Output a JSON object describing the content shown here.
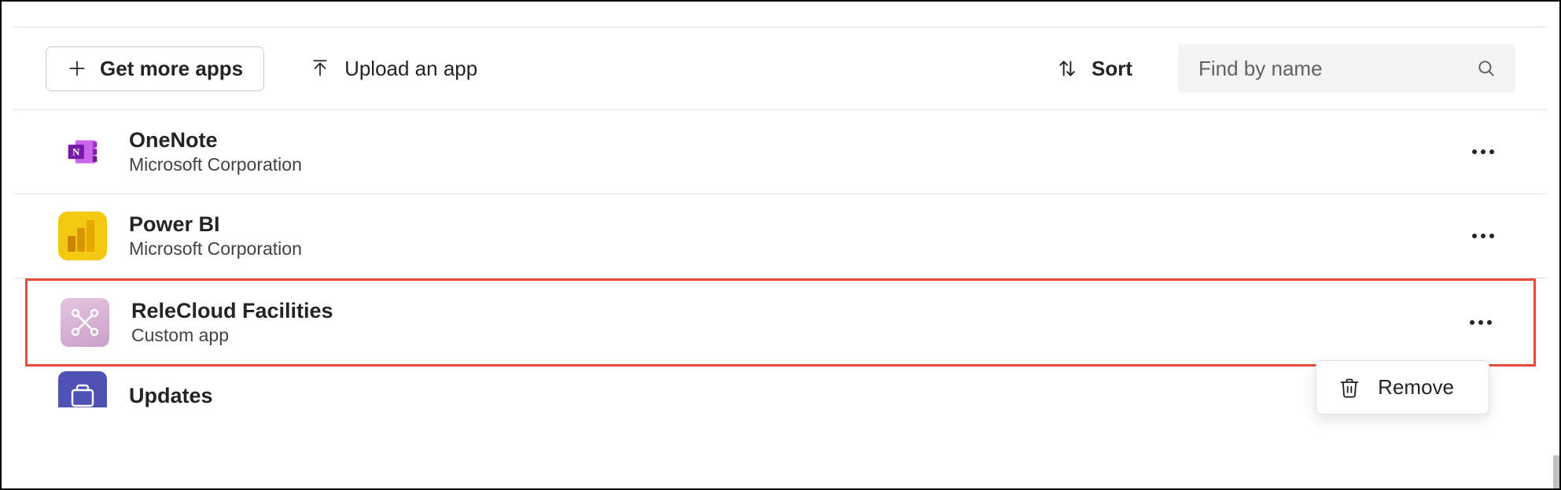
{
  "toolbar": {
    "get_more_apps": "Get more apps",
    "upload_app": "Upload an app",
    "sort": "Sort",
    "search_placeholder": "Find by name"
  },
  "apps": [
    {
      "name": "OneNote",
      "publisher": "Microsoft Corporation",
      "icon": "onenote"
    },
    {
      "name": "Power BI",
      "publisher": "Microsoft Corporation",
      "icon": "powerbi"
    },
    {
      "name": "ReleCloud Facilities",
      "publisher": "Custom app",
      "icon": "relecloud",
      "highlighted": true,
      "menu_open": true
    },
    {
      "name": "Updates",
      "publisher": "",
      "icon": "updates",
      "partial": true
    }
  ],
  "context_menu": {
    "remove": "Remove"
  }
}
